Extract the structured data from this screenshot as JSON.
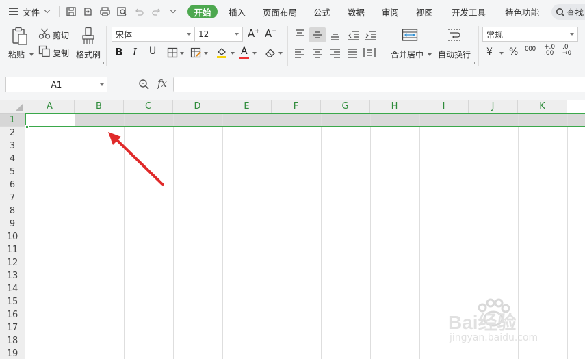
{
  "menu": {
    "file_label": "文件",
    "tabs": [
      "开始",
      "插入",
      "页面布局",
      "公式",
      "数据",
      "审阅",
      "视图",
      "开发工具",
      "特色功能"
    ],
    "active_tab": "开始",
    "search_label": "查找"
  },
  "ribbon": {
    "paste_label": "粘贴",
    "cut_label": "剪切",
    "copy_label": "复制",
    "format_painter_label": "格式刷",
    "font_name": "宋体",
    "font_size": "12",
    "bold_glyph": "B",
    "italic_glyph": "I",
    "underline_glyph": "U",
    "merge_label": "合并居中",
    "wrap_label": "自动换行",
    "number_format": "常规",
    "currency_glyph": "¥",
    "percent_glyph": "%",
    "thousands_glyph": "000"
  },
  "formula_bar": {
    "name_box": "A1",
    "fx_label": "fx",
    "formula_value": ""
  },
  "sheet": {
    "columns": [
      "A",
      "B",
      "C",
      "D",
      "E",
      "F",
      "G",
      "H",
      "I",
      "J",
      "K"
    ],
    "rows": [
      "1",
      "2",
      "3",
      "4",
      "5",
      "6",
      "7",
      "8",
      "9",
      "10",
      "11",
      "12",
      "13",
      "14",
      "15",
      "16",
      "17",
      "18",
      "19"
    ],
    "selected_row": "1",
    "active_cell": "A1"
  },
  "watermark": {
    "brand": "Bai经验",
    "url": "jingyan.baidu.com"
  },
  "colors": {
    "accent_green": "#4da84f",
    "selection_border": "#3aa84a",
    "annotation_arrow": "#e02a2a"
  }
}
